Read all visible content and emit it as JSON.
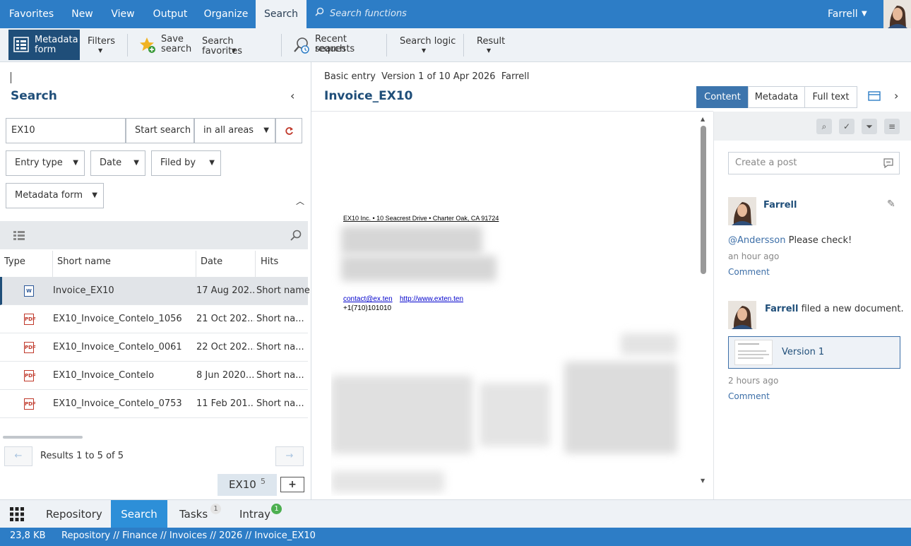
{
  "menu": {
    "items": [
      "Favorites",
      "New",
      "View",
      "Output",
      "Organize",
      "Search"
    ],
    "active": "Search",
    "search_placeholder": "Search functions",
    "user": "Farrell"
  },
  "ribbon": {
    "metadata_form": [
      "Metadata",
      "form"
    ],
    "filters": "Filters",
    "save_search": [
      "Save",
      "search"
    ],
    "search_favorites": "Search favorites",
    "recent_search": [
      "Recent search",
      "requests"
    ],
    "search_logic": "Search logic",
    "result": "Result"
  },
  "left": {
    "title": "Search",
    "query": "EX10",
    "start_search": "Start search",
    "area": "in all areas",
    "filters": [
      "Entry type",
      "Date",
      "Filed by"
    ],
    "metadata_form": "Metadata form",
    "columns": [
      "Type",
      "Short name",
      "Date",
      "Hits"
    ],
    "rows": [
      {
        "type": "word",
        "name": "Invoice_EX10",
        "date": "17 Aug 202...",
        "hits": "Short name"
      },
      {
        "type": "pdf",
        "name": "EX10_Invoice_Contelo_1056",
        "date": "21 Oct 202...",
        "hits": "Short na..."
      },
      {
        "type": "pdf",
        "name": "EX10_Invoice_Contelo_0061",
        "date": "22 Oct 202...",
        "hits": "Short na..."
      },
      {
        "type": "pdf",
        "name": "EX10_Invoice_Contelo",
        "date": "8 Jun 2020...",
        "hits": "Short na..."
      },
      {
        "type": "pdf",
        "name": "EX10_Invoice_Contelo_0753",
        "date": "11 Feb 201...",
        "hits": "Short na..."
      }
    ],
    "results_text": "Results 1 to 5 of 5",
    "saved_tab": {
      "label": "EX10",
      "count": "5"
    },
    "add": "+"
  },
  "middle": {
    "meta_line": "Basic entry  Version 1 of 10 Apr 2026  Farrell",
    "doc_title": "Invoice_EX10",
    "tabs": [
      "Content",
      "Metadata",
      "Full text"
    ],
    "active_tab": "Content",
    "doc": {
      "header": "EX10 Inc. • 10 Seacrest Drive • Charter Oak, CA 91724",
      "email": "contact@ex.ten",
      "url": "http://www.exten.ten",
      "phone": "+1(710)101010"
    }
  },
  "feed": {
    "post_placeholder": "Create a post",
    "entries": [
      {
        "author": "Farrell",
        "mention": "@Andersson",
        "text": " Please check!",
        "time": "an hour ago",
        "action": "Comment"
      },
      {
        "author": "Farrell",
        "text": " filed a new document.",
        "version": "Version 1",
        "time": "2 hours ago",
        "action": "Comment"
      }
    ]
  },
  "bottom_nav": {
    "items": [
      "Repository",
      "Search",
      "Tasks",
      "Intray"
    ],
    "active": "Search",
    "tasks_badge": "1",
    "intray_badge": "1"
  },
  "status": {
    "size": "23,8 KB",
    "path": "Repository // Finance // Invoices // 2026 // Invoice_EX10"
  },
  "colors": {
    "accent": "#2d7dc6",
    "dark": "#1f4e79",
    "link": "#3d6fa8",
    "badge_green": "#4caf50"
  }
}
